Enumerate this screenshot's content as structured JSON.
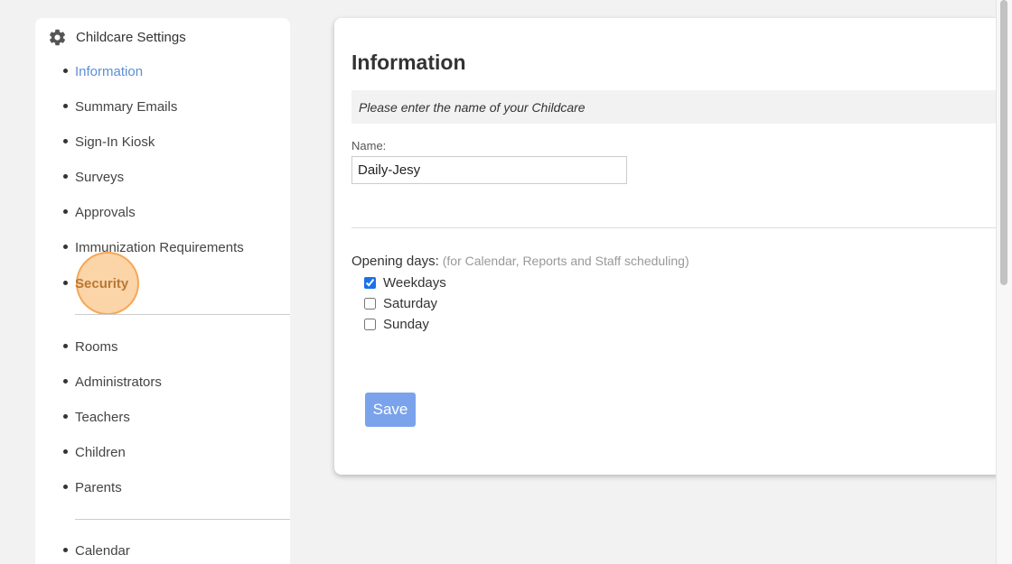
{
  "sidebar": {
    "title": "Childcare Settings",
    "items": [
      {
        "label": "Information"
      },
      {
        "label": "Summary Emails"
      },
      {
        "label": "Sign-In Kiosk"
      },
      {
        "label": "Surveys"
      },
      {
        "label": "Approvals"
      },
      {
        "label": "Immunization Requirements"
      },
      {
        "label": "Security"
      },
      {
        "label": "Rooms"
      },
      {
        "label": "Administrators"
      },
      {
        "label": "Teachers"
      },
      {
        "label": "Children"
      },
      {
        "label": "Parents"
      },
      {
        "label": "Calendar"
      }
    ],
    "active_item": "Information",
    "highlighted_item": "Security",
    "icon": "gear-icon"
  },
  "main": {
    "title": "Information",
    "notice": "Please enter the name of your Childcare",
    "name_label": "Name:",
    "name_value": "Daily-Jesy",
    "opening_days_label": "Opening days:",
    "opening_days_hint": "(for Calendar, Reports and Staff scheduling)",
    "days": [
      {
        "label": "Weekdays",
        "checked": true
      },
      {
        "label": "Saturday",
        "checked": false
      },
      {
        "label": "Sunday",
        "checked": false
      }
    ],
    "save_label": "Save"
  },
  "colors": {
    "active_link": "#5b8fd6",
    "highlight": "#f8b060",
    "save_button": "#7ba3ec",
    "background": "#f2f2f2"
  }
}
